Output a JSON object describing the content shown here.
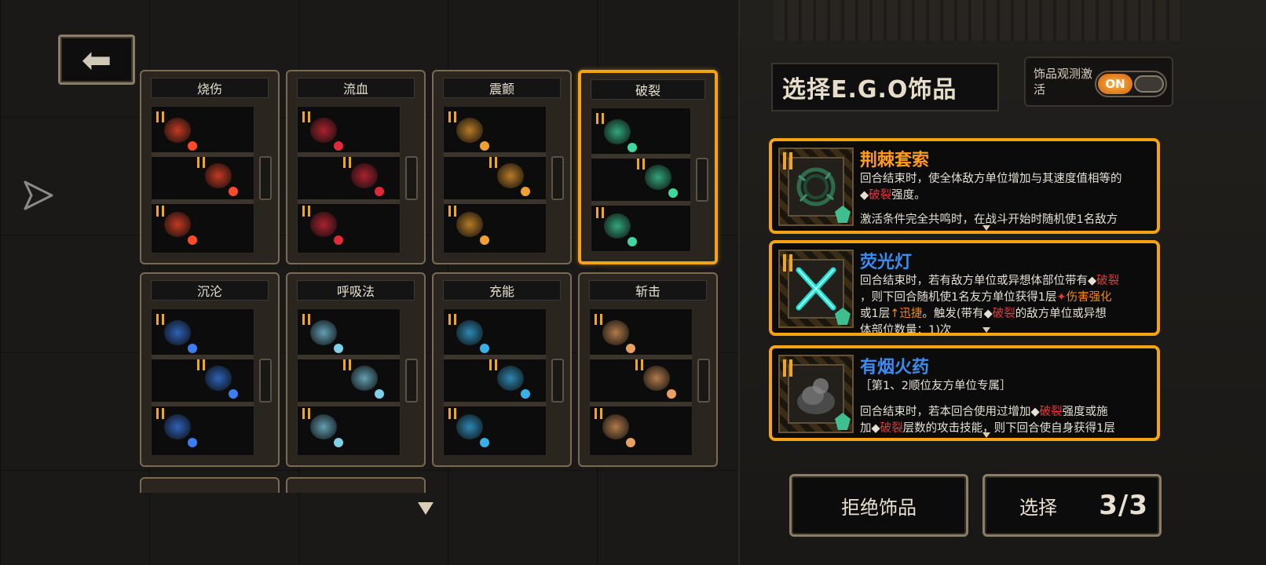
{
  "header": {
    "back_icon": "left-arrow-icon",
    "title": "选择E.G.O饰品"
  },
  "observe": {
    "label": "饰品观测激活",
    "toggle_state": "ON"
  },
  "sets": [
    {
      "name": "烧伤",
      "selected": false,
      "tag_color": "#ff4a2a"
    },
    {
      "name": "流血",
      "selected": false,
      "tag_color": "#e02a3a"
    },
    {
      "name": "震颤",
      "selected": false,
      "tag_color": "#f0a030"
    },
    {
      "name": "破裂",
      "selected": true,
      "tag_color": "#3fd9a0"
    },
    {
      "name": "沉沦",
      "selected": false,
      "tag_color": "#3a7ef0"
    },
    {
      "name": "呼吸法",
      "selected": false,
      "tag_color": "#7fd0e8"
    },
    {
      "name": "充能",
      "selected": false,
      "tag_color": "#3ab0e8"
    },
    {
      "name": "斩击",
      "selected": false,
      "tag_color": "#e8a060"
    }
  ],
  "cards": [
    {
      "name": "荆棘套索",
      "name_color": "#ff9a1a",
      "desc_a": "回合结束时，使全体敌方单位增加与其速度值相等的",
      "desc_b_kw": "破裂",
      "desc_b_rest": "强度。",
      "desc_c": "激活条件完全共鸣时，在战斗开始时随机使1名敌方"
    },
    {
      "name": "荧光灯",
      "name_color": "#3a8cf0",
      "desc_a": "回合结束时，若有敌方单位或异想体部位带有",
      "desc_a_kw": "破裂",
      "desc_b": "，则下回合随机使1名友方单位获得1层",
      "desc_b_kw": "伤害强化",
      "desc_c_pre": "或1层",
      "desc_c_kw": "迅捷",
      "desc_c_mid": "。触发(带有",
      "desc_c_kw2": "破裂",
      "desc_c_rest": "的敌方单位或异想",
      "desc_d": "体部位数量：1)次"
    },
    {
      "name": "有烟火药",
      "name_color": "#3a8cf0",
      "desc_a": "［第1、2顺位友方单位专属］",
      "desc_b_pre": "回合结束时，若本回合使用过增加",
      "desc_b_kw": "破裂",
      "desc_b_rest": "强度或施",
      "desc_c_pre": "加",
      "desc_c_kw": "破裂",
      "desc_c_rest": "层数的攻击技能，则下回合使自身获得1层"
    }
  ],
  "buttons": {
    "refuse": "拒绝饰品",
    "select": "选择",
    "select_count": "3/3"
  }
}
